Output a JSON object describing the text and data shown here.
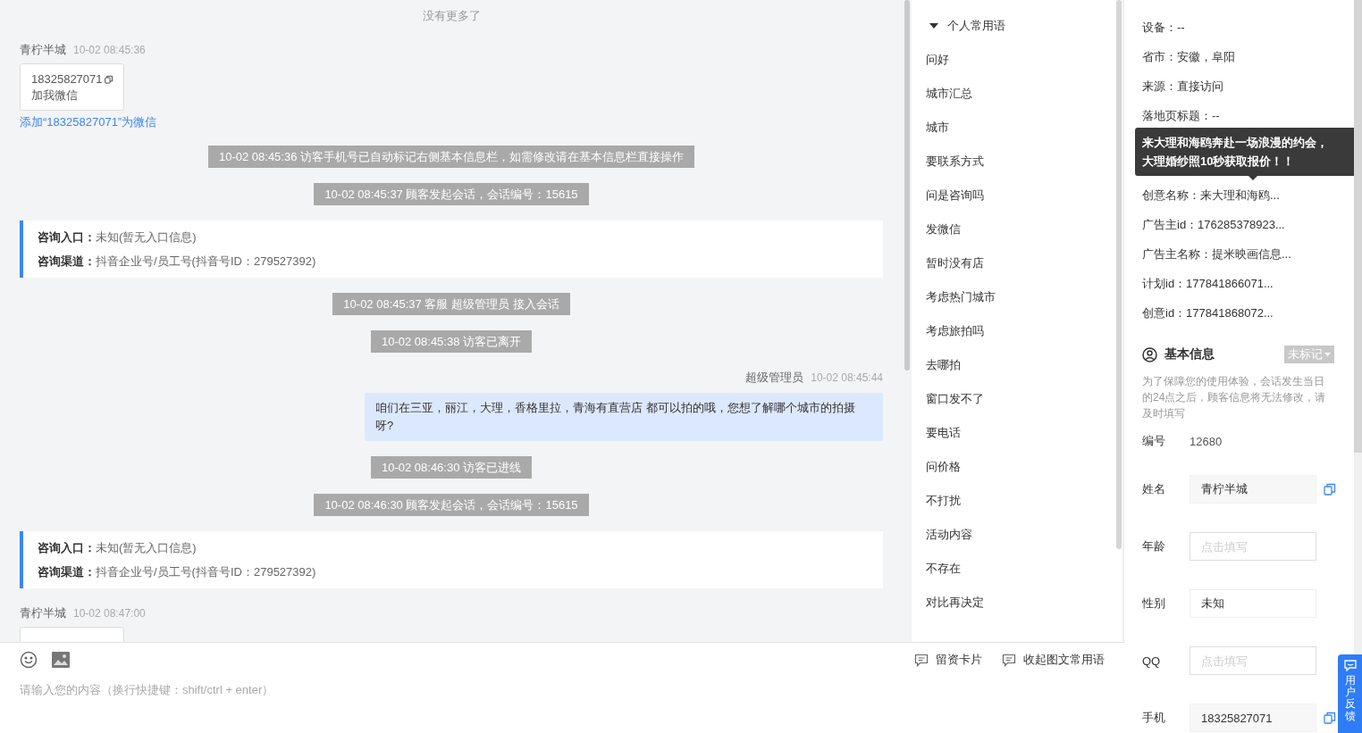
{
  "chat": {
    "end_note": "没有更多了",
    "messages": [
      {
        "kind": "visitor",
        "name": "青柠半城",
        "time": "10-02 08:45:36",
        "card": {
          "number": "18325827071",
          "caption": "加我微信"
        },
        "link": "添加“18325827071”为微信"
      },
      {
        "kind": "system",
        "text": "10-02 08:45:36 访客手机号已自动标记右侧基本信息栏，如需修改请在基本信息栏直接操作"
      },
      {
        "kind": "system",
        "text": "10-02 08:45:37 顾客发起会话，会话编号：15615"
      },
      {
        "kind": "info",
        "rows": [
          {
            "label": "咨询入口：",
            "value": "未知(暂无入口信息)"
          },
          {
            "label": "咨询渠道：",
            "value": "抖音企业号/员工号(抖音号ID：279527392)"
          }
        ]
      },
      {
        "kind": "system",
        "text": "10-02 08:45:37 客服 超级管理员 接入会话"
      },
      {
        "kind": "system",
        "text": "10-02 08:45:38 访客已离开"
      },
      {
        "kind": "agent",
        "name": "超级管理员",
        "time": "10-02 08:45:44",
        "text": "咱们在三亚，丽江，大理，香格里拉，青海有直营店 都可以拍的哦，您想了解哪个城市的拍摄呀?"
      },
      {
        "kind": "system",
        "text": "10-02 08:46:30 访客已进线"
      },
      {
        "kind": "system",
        "text": "10-02 08:46:30 顾客发起会话，会话编号：15615"
      },
      {
        "kind": "info",
        "rows": [
          {
            "label": "咨询入口：",
            "value": "未知(暂无入口信息)"
          },
          {
            "label": "咨询渠道：",
            "value": "抖音企业号/员工号(抖音号ID：279527392)"
          }
        ]
      },
      {
        "kind": "visitor",
        "name": "青柠半城",
        "time": "10-02 08:47:00"
      }
    ]
  },
  "phrases": {
    "title": "个人常用语",
    "expanded": true,
    "items": [
      "问好",
      "城市汇总",
      "城市",
      "要联系方式",
      "问是咨询吗",
      "发微信",
      "暂时没有店",
      "考虑热门城市",
      "考虑旅拍吗",
      "去哪拍",
      "窗口发不了",
      "要电话",
      "问价格",
      "不打扰",
      "活动内容",
      "不存在",
      "对比再决定"
    ]
  },
  "composer": {
    "placeholder": "请输入您的内容（换行快捷键：shift/ctrl + enter）",
    "actions": [
      "留资卡片",
      "收起图文常用语"
    ]
  },
  "visitor_info": {
    "details_top": [
      "设备：--",
      "省市：安徽，阜阳",
      "来源：直接访问",
      "落地页标题：--"
    ],
    "tooltip": "来大理和海鸥奔赴一场浪漫的约会，大理婚纱照10秒获取报价！！",
    "details_bottom": [
      "创意名称：来大理和海鸥...",
      "广告主id：176285378923...",
      "广告主名称：提米映画信息...",
      "计划id：177841866071...",
      "创意id：177841868072..."
    ],
    "basic": {
      "title": "基本信息",
      "tag": "未标记",
      "note": "为了保障您的使用体验，会话发生当日的24点之后，顾客信息将无法修改，请及时填写",
      "fields": [
        {
          "label": "编号",
          "kind": "text",
          "value": "12680"
        },
        {
          "label": "姓名",
          "kind": "filled",
          "value": "青柠半城",
          "copy": true
        },
        {
          "label": "年龄",
          "kind": "input",
          "placeholder": "点击填写"
        },
        {
          "label": "性别",
          "kind": "plain",
          "value": "未知"
        },
        {
          "label": "QQ",
          "kind": "input",
          "placeholder": "点击填写"
        },
        {
          "label": "手机",
          "kind": "filled",
          "value": "18325827071",
          "copy": true
        }
      ]
    }
  },
  "feedback": {
    "label": "用户反馈"
  }
}
